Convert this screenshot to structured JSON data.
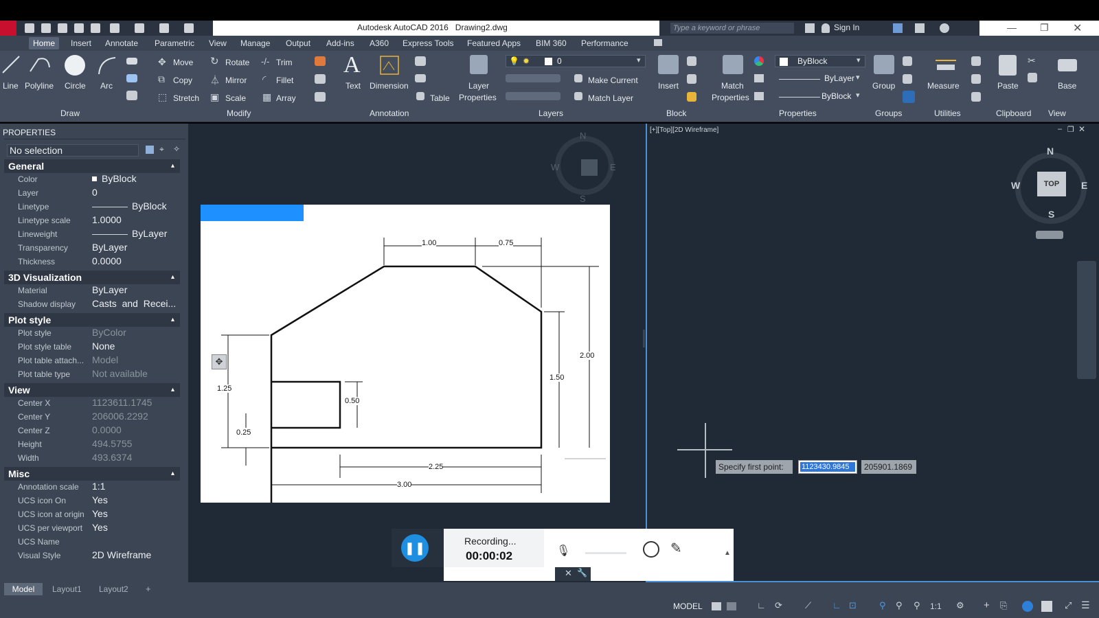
{
  "app": {
    "title": "Autodesk AutoCAD 2016",
    "file": "Drawing2.dwg",
    "search_placeholder": "Type a keyword or phrase",
    "sign_in": "Sign In"
  },
  "menu_tabs": [
    "Home",
    "Insert",
    "Annotate",
    "Parametric",
    "View",
    "Manage",
    "Output",
    "Add-ins",
    "A360",
    "Express Tools",
    "Featured Apps",
    "BIM 360",
    "Performance"
  ],
  "ribbon": {
    "draw": {
      "line": "Line",
      "polyline": "Polyline",
      "circle": "Circle",
      "arc": "Arc",
      "section": "Draw"
    },
    "modify": {
      "move": "Move",
      "rotate": "Rotate",
      "trim": "Trim",
      "copy": "Copy",
      "mirror": "Mirror",
      "fillet": "Fillet",
      "stretch": "Stretch",
      "scale": "Scale",
      "array": "Array",
      "section": "Modify"
    },
    "annotation": {
      "text": "Text",
      "dimension": "Dimension",
      "table": "Table",
      "section": "Annotation"
    },
    "layers": {
      "layer_properties_1": "Layer",
      "layer_properties_2": "Properties",
      "layer_value": "0",
      "make_current": "Make Current",
      "match_layer": "Match Layer",
      "section": "Layers"
    },
    "block": {
      "insert": "Insert",
      "section": "Block"
    },
    "properties": {
      "match_1": "Match",
      "match_2": "Properties",
      "color": "ByBlock",
      "linetype": "ByLayer",
      "lineweight": "ByBlock",
      "section": "Properties"
    },
    "groups": {
      "group": "Group",
      "section": "Groups"
    },
    "utilities": {
      "measure": "Measure",
      "section": "Utilities"
    },
    "clipboard": {
      "paste": "Paste",
      "section": "Clipboard"
    },
    "view": {
      "base": "Base",
      "section": "View"
    }
  },
  "properties_panel": {
    "title": "PROPERTIES",
    "selection": "No selection",
    "sections": {
      "general": "General",
      "viz": "3D Visualization",
      "plot": "Plot style",
      "view": "View",
      "misc": "Misc"
    },
    "general": [
      {
        "k": "Color",
        "v": "ByBlock"
      },
      {
        "k": "Layer",
        "v": "0"
      },
      {
        "k": "Linetype",
        "v": "ByBlock"
      },
      {
        "k": "Linetype scale",
        "v": "1.0000"
      },
      {
        "k": "Lineweight",
        "v": "ByLayer"
      },
      {
        "k": "Transparency",
        "v": "ByLayer"
      },
      {
        "k": "Thickness",
        "v": "0.0000"
      }
    ],
    "viz": [
      {
        "k": "Material",
        "v": "ByLayer"
      },
      {
        "k": "Shadow display",
        "v": "Casts  and  Recei..."
      }
    ],
    "plot": [
      {
        "k": "Plot style",
        "v": "ByColor"
      },
      {
        "k": "Plot style table",
        "v": "None"
      },
      {
        "k": "Plot table attach...",
        "v": "Model"
      },
      {
        "k": "Plot table type",
        "v": "Not available"
      }
    ],
    "view": [
      {
        "k": "Center X",
        "v": "1123611.1745"
      },
      {
        "k": "Center Y",
        "v": "206006.2292"
      },
      {
        "k": "Center Z",
        "v": "0.0000"
      },
      {
        "k": "Height",
        "v": "494.5755"
      },
      {
        "k": "Width",
        "v": "493.6374"
      }
    ],
    "misc": [
      {
        "k": "Annotation scale",
        "v": "1:1"
      },
      {
        "k": "UCS icon On",
        "v": "Yes"
      },
      {
        "k": "UCS icon at origin",
        "v": "Yes"
      },
      {
        "k": "UCS per viewport",
        "v": "Yes"
      },
      {
        "k": "UCS Name",
        "v": ""
      },
      {
        "k": "Visual Style",
        "v": "2D Wireframe"
      }
    ]
  },
  "viewport2": {
    "label": "[+][Top][2D Wireframe]",
    "compass": {
      "n": "N",
      "s": "S",
      "e": "E",
      "w": "W",
      "top": "TOP"
    },
    "prompt": "Specify first point:",
    "x": "1123430.9845",
    "y": "205901.1869"
  },
  "viewport1": {
    "compass": {
      "n": "N",
      "s": "S",
      "e": "E",
      "w": "W"
    }
  },
  "drawing": {
    "dims": [
      "1.00",
      "0.75",
      "2.00",
      "1.50",
      "1.25",
      "0.50",
      "0.25",
      "2.25",
      "3.00"
    ]
  },
  "recorder": {
    "status": "Recording...",
    "time": "00:00:02"
  },
  "layout_tabs": [
    "Model",
    "Layout1",
    "Layout2",
    "+"
  ],
  "statusbar": {
    "model": "MODEL",
    "scale": "1:1"
  }
}
